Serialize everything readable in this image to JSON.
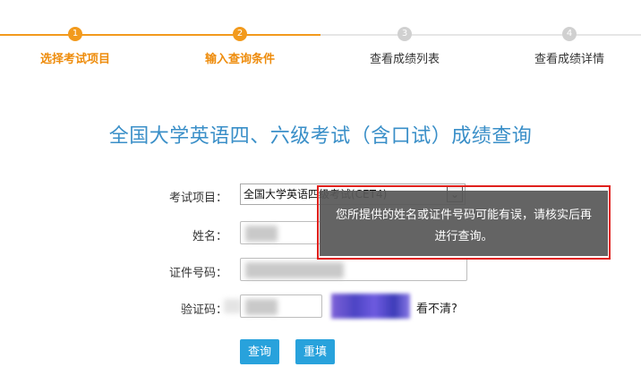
{
  "steps": [
    {
      "number": "1",
      "label": "选择考试项目",
      "state": "done"
    },
    {
      "number": "2",
      "label": "输入查询条件",
      "state": "done"
    },
    {
      "number": "3",
      "label": "查看成绩列表",
      "state": "todo"
    },
    {
      "number": "4",
      "label": "查看成绩详情",
      "state": "todo"
    }
  ],
  "page_title": "全国大学英语四、六级考试（含口试）成绩查询",
  "form": {
    "exam_label": "考试项目：",
    "exam_value": "全国大学英语四级考试(CET4)",
    "name_label": "姓名：",
    "id_label": "证件号码：",
    "captcha_label": "验证码：",
    "captcha_refresh": "看不清?"
  },
  "buttons": {
    "query": "查询",
    "reset": "重填"
  },
  "toast": {
    "line1": "您所提供的姓名或证件号码可能有误，请核实后再",
    "line2": "进行查询。"
  },
  "colors": {
    "accent_orange": "#f29a1d",
    "title_blue": "#3a8fc8",
    "button_blue": "#28a2dc",
    "annotation_red": "#e0201c"
  },
  "icons": {
    "dropdown": "chevron-down-icon"
  }
}
